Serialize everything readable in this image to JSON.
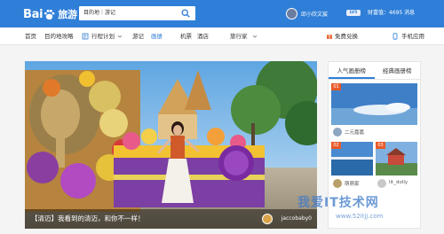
{
  "header": {
    "logo_text": "Bai",
    "logo_suffix": "旅游",
    "search_filter": "目的地｜游记",
    "username": "邱小欣文宸",
    "vip_label": "LV5",
    "wealth_text": "财富值：4695    消息"
  },
  "nav": {
    "items": [
      {
        "label": "首页"
      },
      {
        "label": "目的地攻略"
      },
      {
        "label": "行程计划"
      },
      {
        "label": "游记"
      },
      {
        "label": "画册"
      },
      {
        "label": "机票"
      },
      {
        "label": "酒店"
      },
      {
        "label": "旅行家"
      },
      {
        "label": "免费兑换"
      },
      {
        "label": "手机应用"
      }
    ]
  },
  "hero": {
    "caption": "【清迈】我看到的清迈，和你不一样！",
    "author": "jaccobaby0"
  },
  "right_panel": {
    "tabs": [
      {
        "label": "人气画册榜"
      },
      {
        "label": "经典画册榜"
      }
    ],
    "cards": [
      {
        "rank": "01",
        "user": "二元嘉嘉"
      },
      {
        "rank": "02",
        "user": "萌萌家"
      },
      {
        "rank": "03",
        "user": "lit_dolly"
      }
    ]
  },
  "watermark": {
    "text": "我爱IT技术网",
    "sub": "www.52itjj.com"
  }
}
